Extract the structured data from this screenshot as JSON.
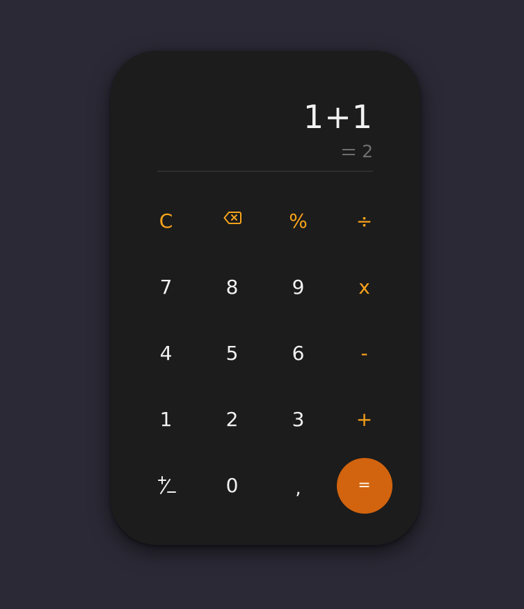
{
  "display": {
    "expression": "1+1",
    "result": "2"
  },
  "keys": {
    "clear": "C",
    "backspace_icon": "backspace-icon",
    "percent": "%",
    "divide": "÷",
    "seven": "7",
    "eight": "8",
    "nine": "9",
    "multiply": "x",
    "four": "4",
    "five": "5",
    "six": "6",
    "minus": "-",
    "one": "1",
    "two": "2",
    "three": "3",
    "plus": "+",
    "plus_minus_icon": "plus-minus-icon",
    "zero": "0",
    "decimal": ",",
    "equals": "="
  },
  "colors": {
    "background": "#2b2935",
    "body": "#1c1c1c",
    "operator": "#f7a21b",
    "equals_button": "#d2640f",
    "digit": "#f2f2f2",
    "result": "#6f6f6f"
  }
}
